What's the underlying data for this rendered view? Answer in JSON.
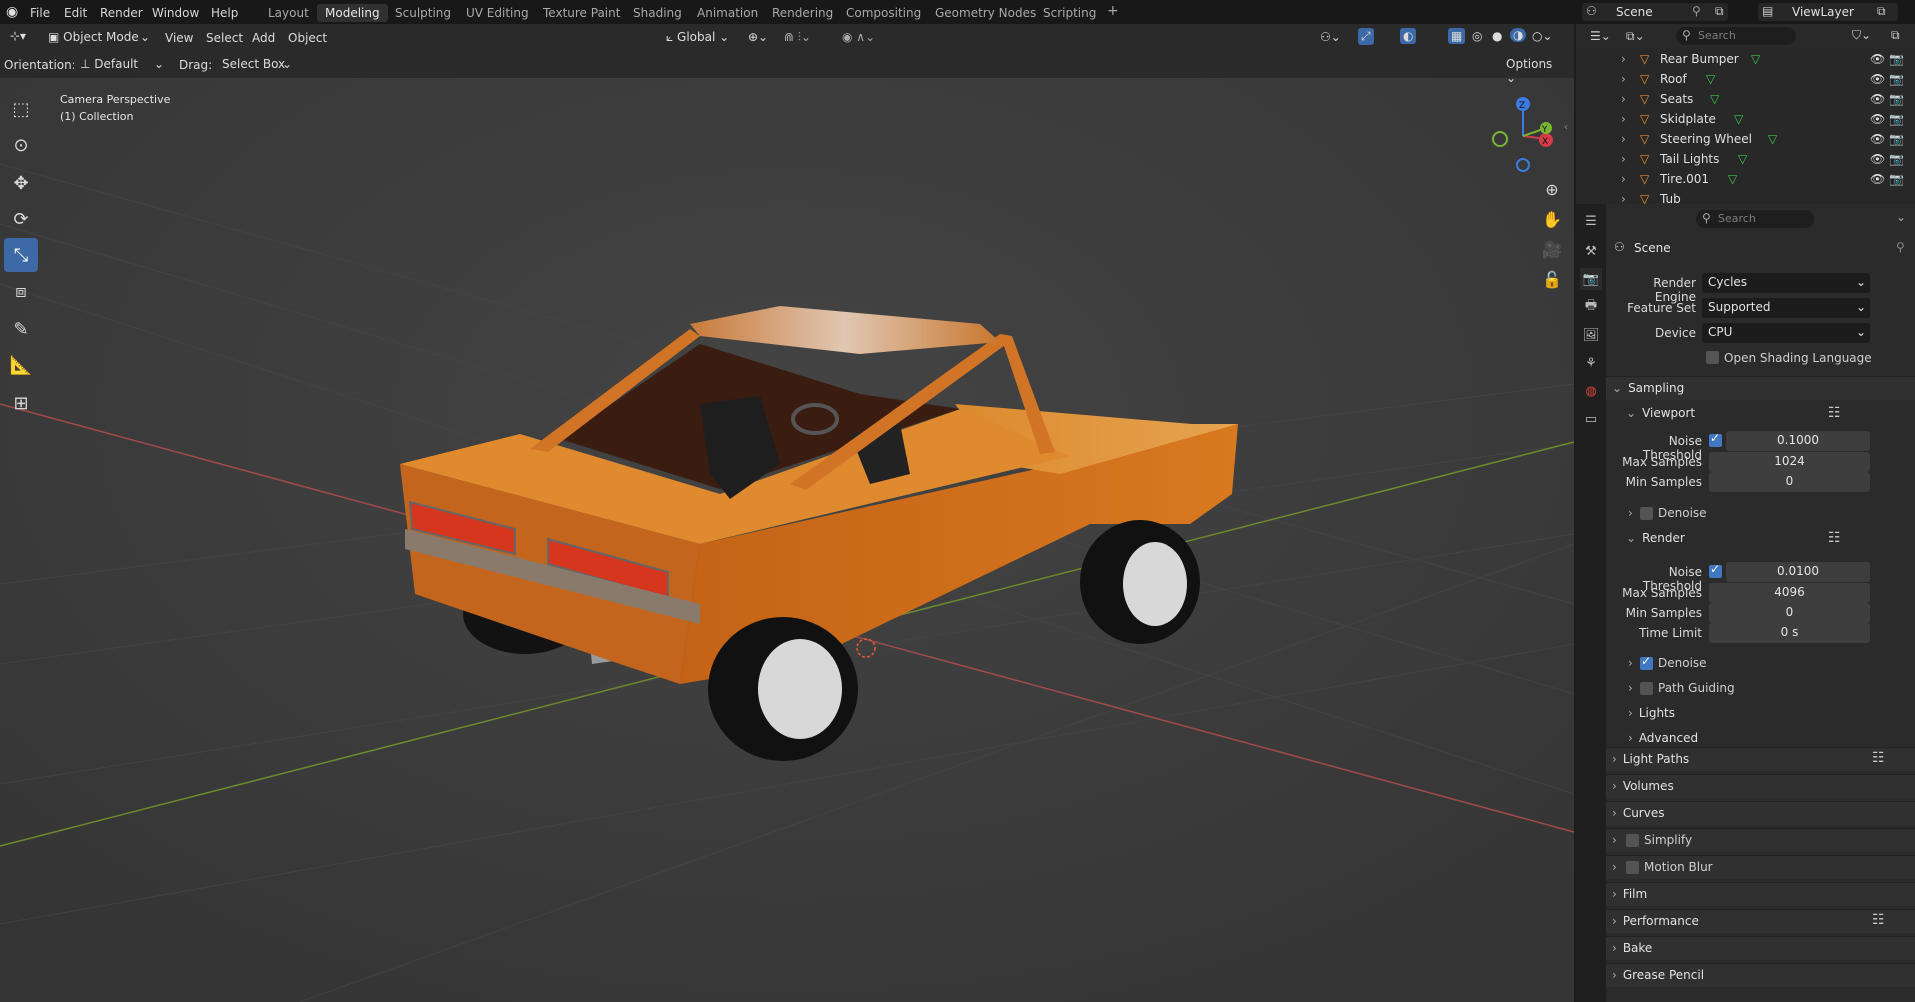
{
  "app": {
    "menus": [
      "File",
      "Edit",
      "Render",
      "Window",
      "Help"
    ],
    "workspaces": [
      "Layout",
      "Modeling",
      "Sculpting",
      "UV Editing",
      "Texture Paint",
      "Shading",
      "Animation",
      "Rendering",
      "Compositing",
      "Geometry Nodes",
      "Scripting",
      "+"
    ],
    "active_workspace": "Modeling",
    "scene_name": "Scene",
    "view_layer": "ViewLayer"
  },
  "viewport": {
    "mode": "Object Mode",
    "menu": [
      "View",
      "Select",
      "Add",
      "Object"
    ],
    "transform_orientation": "Global",
    "orientation_label": "Orientation:",
    "orientation_value": "Default",
    "drag_label": "Drag:",
    "drag_value": "Select Box",
    "options_label": "Options",
    "overlay_title": "Camera Perspective",
    "overlay_collection": "(1) Collection",
    "gizmo_axes": {
      "x": "X",
      "y": "Y",
      "z": "Z"
    }
  },
  "outliner": {
    "search_placeholder": "Search",
    "items": [
      {
        "name": "Rear Bumper"
      },
      {
        "name": "Roof"
      },
      {
        "name": "Seats"
      },
      {
        "name": "Skidplate"
      },
      {
        "name": "Steering Wheel"
      },
      {
        "name": "Tail Lights"
      },
      {
        "name": "Tire.001"
      },
      {
        "name": "Tub"
      }
    ]
  },
  "properties": {
    "search_placeholder": "Search",
    "context": "Scene",
    "render_engine_label": "Render Engine",
    "render_engine": "Cycles",
    "feature_set_label": "Feature Set",
    "feature_set": "Supported",
    "device_label": "Device",
    "device": "CPU",
    "osl_label": "Open Shading Language",
    "sampling": {
      "title": "Sampling",
      "viewport": {
        "title": "Viewport",
        "noise_threshold_label": "Noise Threshold",
        "noise_threshold": "0.1000",
        "max_samples_label": "Max Samples",
        "max_samples": "1024",
        "min_samples_label": "Min Samples",
        "min_samples": "0",
        "denoise_label": "Denoise"
      },
      "render": {
        "title": "Render",
        "noise_threshold_label": "Noise Threshold",
        "noise_threshold": "0.0100",
        "max_samples_label": "Max Samples",
        "max_samples": "4096",
        "min_samples_label": "Min Samples",
        "min_samples": "0",
        "time_limit_label": "Time Limit",
        "time_limit": "0 s"
      },
      "denoise_label": "Denoise",
      "path_guiding_label": "Path Guiding",
      "lights_label": "Lights",
      "advanced_label": "Advanced"
    },
    "panels": [
      "Light Paths",
      "Volumes",
      "Curves",
      "Simplify",
      "Motion Blur",
      "Film",
      "Performance",
      "Bake",
      "Grease Pencil"
    ]
  },
  "colors": {
    "accent": "#4277c3",
    "car_body": "#d8741f",
    "mesh_icon": "#39c64e",
    "object_icon": "#f08b2b"
  }
}
